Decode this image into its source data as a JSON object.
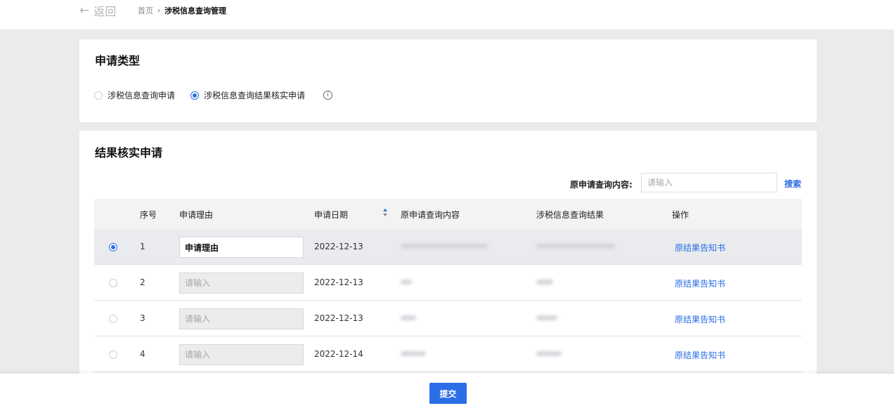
{
  "nav": {
    "back_label": "返回",
    "breadcrumb_home": "首页",
    "breadcrumb_sep": "›",
    "breadcrumb_current": "涉税信息查询管理"
  },
  "apply_type": {
    "title": "申请类型",
    "options": [
      {
        "label": "涉税信息查询申请",
        "selected": false
      },
      {
        "label": "涉税信息查询结果核实申请",
        "selected": true
      }
    ],
    "info_icon": "i"
  },
  "verify": {
    "title": "结果核实申请",
    "search": {
      "label": "原申请查询内容:",
      "placeholder": "请输入",
      "button": "搜索"
    },
    "columns": [
      "序号",
      "申请理由",
      "申请日期",
      "原申请查询内容",
      "涉税信息查询结果",
      "操作"
    ],
    "rows": [
      {
        "index": "1",
        "reason": "申请理由",
        "reason_placeholder": "",
        "date": "2022-12-13",
        "action": "原结果告知书",
        "selected": true
      },
      {
        "index": "2",
        "reason": "",
        "reason_placeholder": "请输入",
        "date": "2022-12-13",
        "action": "原结果告知书",
        "selected": false
      },
      {
        "index": "3",
        "reason": "",
        "reason_placeholder": "请输入",
        "date": "2022-12-13",
        "action": "原结果告知书",
        "selected": false
      },
      {
        "index": "4",
        "reason": "",
        "reason_placeholder": "请输入",
        "date": "2022-12-14",
        "action": "原结果告知书",
        "selected": false
      }
    ]
  },
  "footer": {
    "submit_label": "提交"
  },
  "colors": {
    "accent": "#2b6de6",
    "page_bg": "#ebebeb",
    "selected_row_bg": "#e9ebef"
  }
}
